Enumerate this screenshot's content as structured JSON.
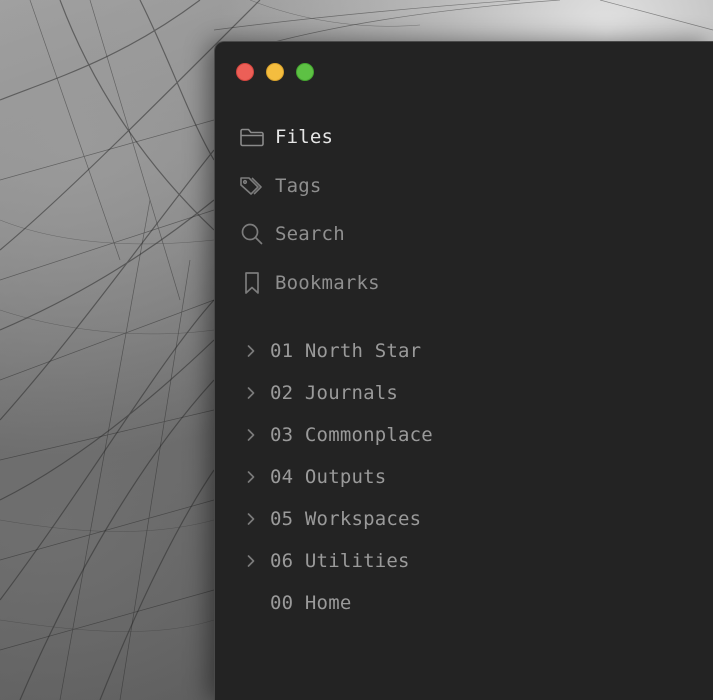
{
  "window": {
    "controls": [
      "close",
      "minimize",
      "maximize"
    ]
  },
  "nav": {
    "items": [
      {
        "label": "Files",
        "icon": "folder-icon",
        "active": true
      },
      {
        "label": "Tags",
        "icon": "tags-icon",
        "active": false
      },
      {
        "label": "Search",
        "icon": "search-icon",
        "active": false
      },
      {
        "label": "Bookmarks",
        "icon": "bookmark-icon",
        "active": false
      }
    ]
  },
  "folders": {
    "items": [
      {
        "label": "01 North Star",
        "expandable": true
      },
      {
        "label": "02 Journals",
        "expandable": true
      },
      {
        "label": "03 Commonplace",
        "expandable": true
      },
      {
        "label": "04 Outputs",
        "expandable": true
      },
      {
        "label": "05 Workspaces",
        "expandable": true
      },
      {
        "label": "06 Utilities",
        "expandable": true
      },
      {
        "label": "00 Home",
        "expandable": false
      }
    ]
  },
  "colors": {
    "window_bg": "#232323",
    "text_active": "#e6e6e6",
    "text_muted": "#8f8f8f",
    "close": "#ec5f57",
    "minimize": "#f4bd3f",
    "maximize": "#5dc144"
  }
}
